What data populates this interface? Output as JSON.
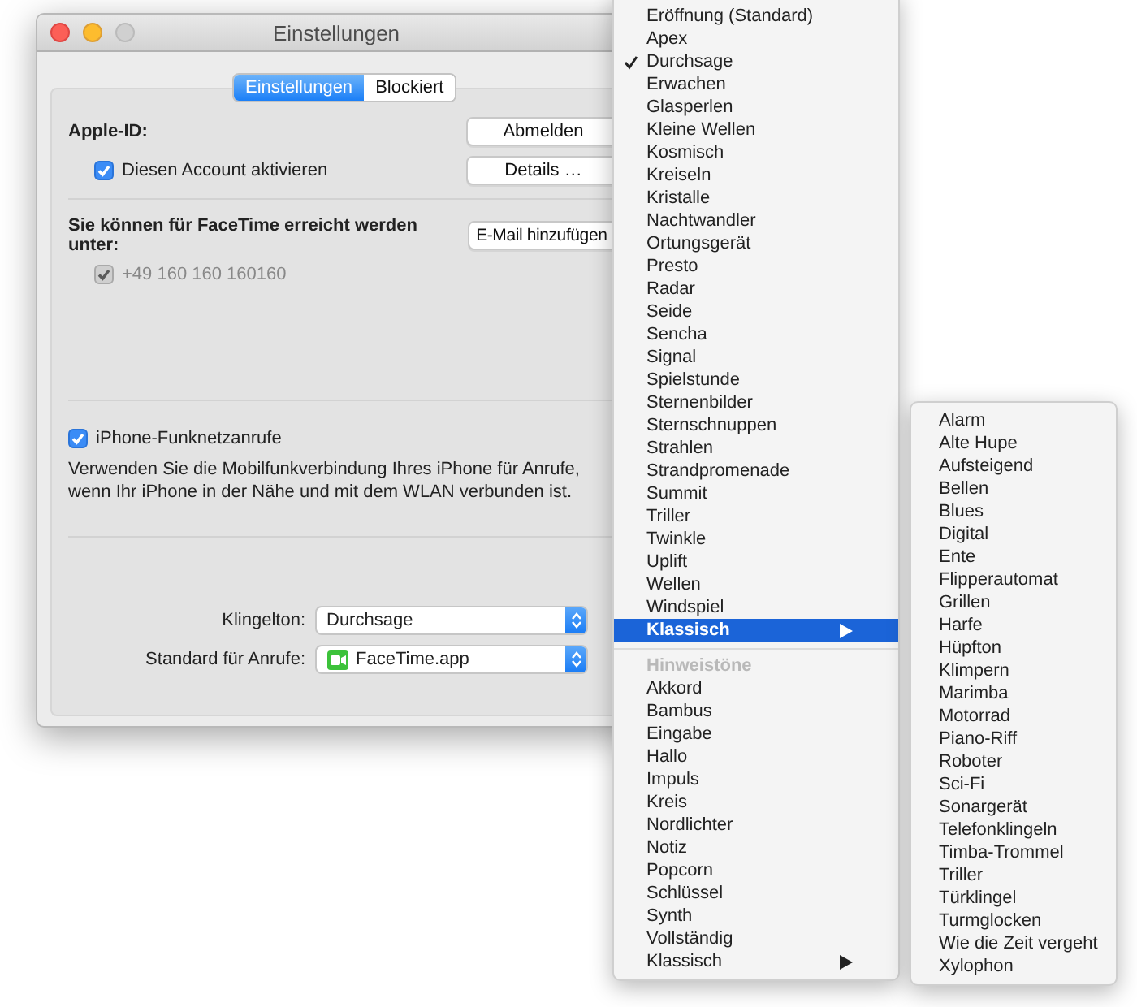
{
  "window": {
    "title": "Einstellungen"
  },
  "tabs": [
    {
      "label": "Einstellungen",
      "selected": true
    },
    {
      "label": "Blockiert",
      "selected": false
    }
  ],
  "apple_id": {
    "label": "Apple-ID:",
    "sign_out_button": "Abmelden",
    "details_button": "Details …",
    "account_checkbox": {
      "label": "Diesen Account aktivieren",
      "checked": true,
      "disabled": false
    }
  },
  "reachable": {
    "label": "Sie können für FaceTime erreicht werden unter:",
    "add_email_button": "E-Mail hinzufügen",
    "addresses": [
      {
        "label": "+49 160 160 160160",
        "checked": true,
        "disabled": true
      }
    ]
  },
  "iphone_calls": {
    "checkbox": {
      "label": "iPhone-Funknetzanrufe",
      "checked": true,
      "disabled": false
    },
    "description": "Verwenden Sie die Mobilfunkverbindung Ihres iPhone für Anrufe, wenn Ihr iPhone in der Nähe und mit dem WLAN verbunden ist."
  },
  "ringtone": {
    "label": "Klingelton:",
    "value": "Durchsage"
  },
  "default_calls": {
    "label": "Standard für Anrufe:",
    "value": "FaceTime.app"
  },
  "ringtone_menu": [
    {
      "kind": "item",
      "label": "Eröffnung (Standard)",
      "checked": false,
      "highlighted": false
    },
    {
      "kind": "item",
      "label": "Apex",
      "checked": false,
      "highlighted": false
    },
    {
      "kind": "item",
      "label": "Durchsage",
      "checked": true,
      "highlighted": false
    },
    {
      "kind": "item",
      "label": "Erwachen",
      "checked": false,
      "highlighted": false
    },
    {
      "kind": "item",
      "label": "Glasperlen",
      "checked": false,
      "highlighted": false
    },
    {
      "kind": "item",
      "label": "Kleine Wellen",
      "checked": false,
      "highlighted": false
    },
    {
      "kind": "item",
      "label": "Kosmisch",
      "checked": false,
      "highlighted": false
    },
    {
      "kind": "item",
      "label": "Kreiseln",
      "checked": false,
      "highlighted": false
    },
    {
      "kind": "item",
      "label": "Kristalle",
      "checked": false,
      "highlighted": false
    },
    {
      "kind": "item",
      "label": "Nachtwandler",
      "checked": false,
      "highlighted": false
    },
    {
      "kind": "item",
      "label": "Ortungsgerät",
      "checked": false,
      "highlighted": false
    },
    {
      "kind": "item",
      "label": "Presto",
      "checked": false,
      "highlighted": false
    },
    {
      "kind": "item",
      "label": "Radar",
      "checked": false,
      "highlighted": false
    },
    {
      "kind": "item",
      "label": "Seide",
      "checked": false,
      "highlighted": false
    },
    {
      "kind": "item",
      "label": "Sencha",
      "checked": false,
      "highlighted": false
    },
    {
      "kind": "item",
      "label": "Signal",
      "checked": false,
      "highlighted": false
    },
    {
      "kind": "item",
      "label": "Spielstunde",
      "checked": false,
      "highlighted": false
    },
    {
      "kind": "item",
      "label": "Sternenbilder",
      "checked": false,
      "highlighted": false
    },
    {
      "kind": "item",
      "label": "Sternschnuppen",
      "checked": false,
      "highlighted": false
    },
    {
      "kind": "item",
      "label": "Strahlen",
      "checked": false,
      "highlighted": false
    },
    {
      "kind": "item",
      "label": "Strandpromenade",
      "checked": false,
      "highlighted": false
    },
    {
      "kind": "item",
      "label": "Summit",
      "checked": false,
      "highlighted": false
    },
    {
      "kind": "item",
      "label": "Triller",
      "checked": false,
      "highlighted": false
    },
    {
      "kind": "item",
      "label": "Twinkle",
      "checked": false,
      "highlighted": false
    },
    {
      "kind": "item",
      "label": "Uplift",
      "checked": false,
      "highlighted": false
    },
    {
      "kind": "item",
      "label": "Wellen",
      "checked": false,
      "highlighted": false
    },
    {
      "kind": "item",
      "label": "Windspiel",
      "checked": false,
      "highlighted": false
    },
    {
      "kind": "submenu",
      "label": "Klassisch",
      "checked": false,
      "highlighted": true
    },
    {
      "kind": "separator"
    },
    {
      "kind": "header",
      "label": "Hinweistöne"
    },
    {
      "kind": "item",
      "label": "Akkord",
      "checked": false,
      "highlighted": false
    },
    {
      "kind": "item",
      "label": "Bambus",
      "checked": false,
      "highlighted": false
    },
    {
      "kind": "item",
      "label": "Eingabe",
      "checked": false,
      "highlighted": false
    },
    {
      "kind": "item",
      "label": "Hallo",
      "checked": false,
      "highlighted": false
    },
    {
      "kind": "item",
      "label": "Impuls",
      "checked": false,
      "highlighted": false
    },
    {
      "kind": "item",
      "label": "Kreis",
      "checked": false,
      "highlighted": false
    },
    {
      "kind": "item",
      "label": "Nordlichter",
      "checked": false,
      "highlighted": false
    },
    {
      "kind": "item",
      "label": "Notiz",
      "checked": false,
      "highlighted": false
    },
    {
      "kind": "item",
      "label": "Popcorn",
      "checked": false,
      "highlighted": false
    },
    {
      "kind": "item",
      "label": "Schlüssel",
      "checked": false,
      "highlighted": false
    },
    {
      "kind": "item",
      "label": "Synth",
      "checked": false,
      "highlighted": false
    },
    {
      "kind": "item",
      "label": "Vollständig",
      "checked": false,
      "highlighted": false
    },
    {
      "kind": "submenu",
      "label": "Klassisch",
      "checked": false,
      "highlighted": false
    }
  ],
  "classic_submenu": [
    "Alarm",
    "Alte Hupe",
    "Aufsteigend",
    "Bellen",
    "Blues",
    "Digital",
    "Ente",
    "Flipperautomat",
    "Grillen",
    "Harfe",
    "Hüpfton",
    "Klimpern",
    "Marimba",
    "Motorrad",
    "Piano-Riff",
    "Roboter",
    "Sci-Fi",
    "Sonargerät",
    "Telefonklingeln",
    "Timba-Trommel",
    "Triller",
    "Türklingel",
    "Turmglocken",
    "Wie die Zeit vergeht",
    "Xylophon"
  ]
}
